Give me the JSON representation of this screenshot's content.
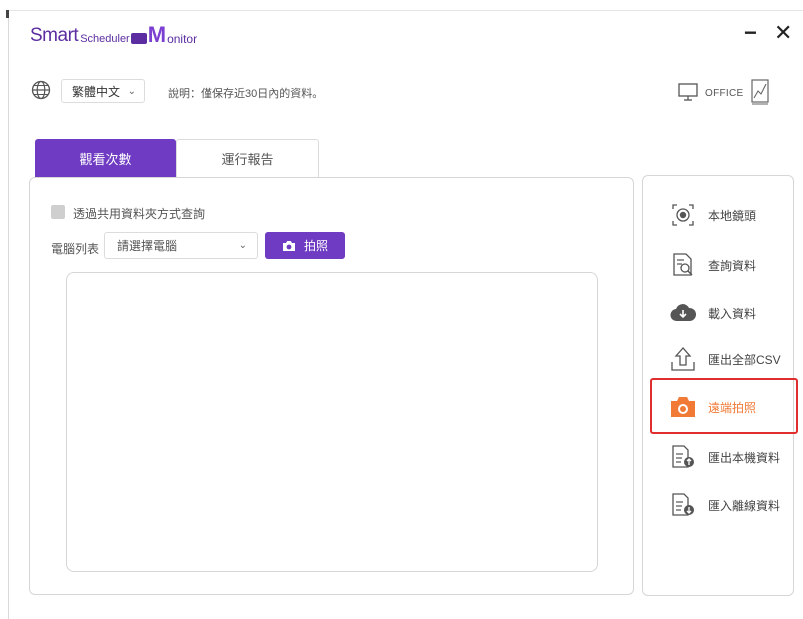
{
  "app": {
    "logo_smart": "Smart",
    "logo_scheduler": "Scheduler",
    "logo_m": "M",
    "logo_monitor": "onitor"
  },
  "window": {
    "minimize_label": "−",
    "close_label": "✕"
  },
  "toolbar": {
    "language_value": "繁體中文",
    "note": "說明：僅保存近30日內的資料。",
    "office_label": "OFFICE"
  },
  "tabs": [
    {
      "label": "觀看次數",
      "active": true
    },
    {
      "label": "運行報告",
      "active": false
    }
  ],
  "main": {
    "shared_folder_label": "透過共用資料夾方式查詢",
    "pc_list_label": "電腦列表",
    "pc_select_placeholder": "請選擇電腦",
    "snapshot_button": "拍照"
  },
  "sidebar": {
    "items": [
      {
        "label": "本地鏡頭",
        "icon": "camera-lens-icon"
      },
      {
        "label": "查詢資料",
        "icon": "document-search-icon"
      },
      {
        "label": "載入資料",
        "icon": "cloud-download-icon"
      },
      {
        "label": "匯出全部CSV",
        "icon": "upload-icon"
      },
      {
        "label": "遠端拍照",
        "icon": "camera-icon",
        "active": true
      },
      {
        "label": "匯出本機資料",
        "icon": "document-export-icon"
      },
      {
        "label": "匯入離線資料",
        "icon": "document-import-icon"
      }
    ]
  },
  "colors": {
    "accent": "#6e3bc2",
    "active_item": "#f07a36",
    "highlight_border": "#e02d2d",
    "icon_gray": "#555555"
  }
}
